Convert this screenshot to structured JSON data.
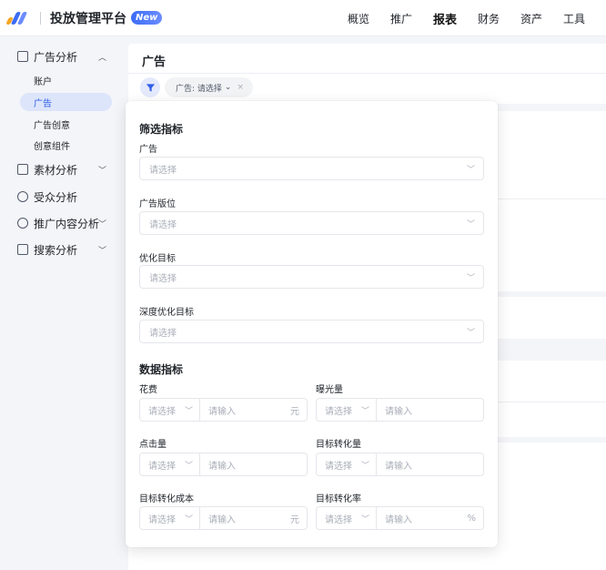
{
  "header": {
    "brand": "投放管理平台",
    "badge": "New",
    "nav": [
      {
        "label": "概览",
        "active": false
      },
      {
        "label": "推广",
        "active": false
      },
      {
        "label": "报表",
        "active": true
      },
      {
        "label": "财务",
        "active": false
      },
      {
        "label": "资产",
        "active": false
      },
      {
        "label": "工具",
        "active": false
      }
    ]
  },
  "sidebar": {
    "ad_analysis": {
      "label": "广告分析",
      "expanded": true
    },
    "sub_items": [
      {
        "label": "账户",
        "active": false
      },
      {
        "label": "广告",
        "active": true
      },
      {
        "label": "广告创意",
        "active": false
      },
      {
        "label": "创意组件",
        "active": false
      }
    ],
    "material_analysis": "素材分析",
    "audience_analysis": "受众分析",
    "content_analysis": "推广内容分析",
    "search_analysis": "搜索分析"
  },
  "main": {
    "title": "广告",
    "filter_chip": "广告: 请选择",
    "filter_chip_arrow": "⌄",
    "filter_chip_close": "×"
  },
  "popover": {
    "filter_title": "筛选指标",
    "fields": {
      "ad": {
        "label": "广告",
        "placeholder": "请选择"
      },
      "placement": {
        "label": "广告版位",
        "placeholder": "请选择"
      },
      "optimization_goal": {
        "label": "优化目标",
        "placeholder": "请选择"
      },
      "deep_goal": {
        "label": "深度优化目标",
        "placeholder": "请选择"
      }
    },
    "data_title": "数据指标",
    "metrics": {
      "cost": {
        "label": "花费",
        "select": "请选择",
        "input": "请输入",
        "unit": "元"
      },
      "impressions": {
        "label": "曝光量",
        "select": "请选择",
        "input": "请输入",
        "unit": ""
      },
      "clicks": {
        "label": "点击量",
        "select": "请选择",
        "input": "请输入",
        "unit": ""
      },
      "conversions": {
        "label": "目标转化量",
        "select": "请选择",
        "input": "请输入",
        "unit": ""
      },
      "conversion_cost": {
        "label": "目标转化成本",
        "select": "请选择",
        "input": "请输入",
        "unit": "元"
      },
      "conversion_rate": {
        "label": "目标转化率",
        "select": "请选择",
        "input": "请输入",
        "unit": "%"
      }
    }
  },
  "colors": {
    "accent": "#2f5de6",
    "active_bg": "#dde5fb",
    "logo": [
      "#f5a623",
      "#3b6cf6",
      "#6b8cff"
    ]
  }
}
